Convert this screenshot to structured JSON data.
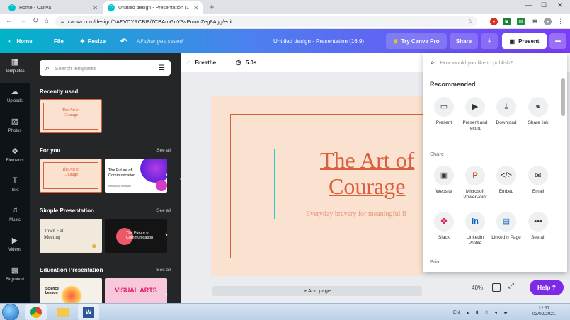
{
  "browser": {
    "tabs": [
      {
        "title": "Home - Canva",
        "favicon": "C"
      },
      {
        "title": "Untitled design - Presentation (1",
        "favicon": "C"
      }
    ],
    "url": "canva.com/design/DAEVDYRCBI8/7CBArnGnYSvPmVoZeg8Agg/edit"
  },
  "topbar": {
    "home": "Home",
    "file": "File",
    "resize": "Resize",
    "saved": "All changes saved",
    "doc_title": "Untitled design - Presentation (16:9)",
    "try_pro": "Try Canva Pro",
    "share": "Share",
    "present": "Present"
  },
  "rail": [
    {
      "label": "Templates",
      "icon": "templates-icon"
    },
    {
      "label": "Uploads",
      "icon": "uploads-icon"
    },
    {
      "label": "Photos",
      "icon": "photos-icon"
    },
    {
      "label": "Elements",
      "icon": "elements-icon"
    },
    {
      "label": "Text",
      "icon": "text-icon"
    },
    {
      "label": "Music",
      "icon": "music-icon"
    },
    {
      "label": "Videos",
      "icon": "videos-icon"
    },
    {
      "label": "Bkground",
      "icon": "background-icon"
    }
  ],
  "panel": {
    "search_placeholder": "Search templates",
    "recently_used": "Recently used",
    "for_you": "For you",
    "simple_presentation": "Simple Presentation",
    "education_presentation": "Education Presentation",
    "see_all": "See all",
    "thumbs": {
      "art_title": "The Art of Courage",
      "art_sub": "Everyday bravery for meaningful life",
      "future": "The Future of Communication",
      "future_sub": "Introducing the team",
      "town_hall": "Town Hall Meeting",
      "science": "Science Lesson",
      "visual_arts": "VISUAL ARTS"
    }
  },
  "context_bar": {
    "animation": "Breathe",
    "duration": "5.0s"
  },
  "slide": {
    "title_line1": "The Art of",
    "title_line2": "Courage",
    "subtitle": "Everyday bravery for meaningful li"
  },
  "editor": {
    "add_page": "+ Add page",
    "zoom": "40%",
    "help": "Help ?"
  },
  "share_menu": {
    "search_placeholder": "How would you like to publish?",
    "recommended": "Recommended",
    "recommended_items": [
      "Present",
      "Present and record",
      "Download",
      "Share link"
    ],
    "share_heading": "Share",
    "share_items": [
      "Website",
      "Microsoft PowerPoint",
      "Embed",
      "Email",
      "Slack",
      "LinkedIn Profile",
      "LinkedIn Page",
      "See all"
    ],
    "print_heading": "Print"
  },
  "taskbar": {
    "lang": "EN",
    "time": "12:37",
    "date": "03/02/2021"
  },
  "colors": {
    "accent_purple": "#7d2ae8",
    "slide_bg": "#fbe1cf",
    "slide_title": "#d9603d",
    "selection": "#2bc6cc"
  }
}
